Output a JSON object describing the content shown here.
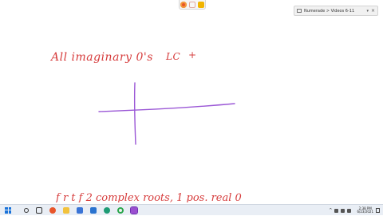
{
  "toolbar": {
    "app_icon": "firefox-icon",
    "pen_icon": "pen-icon",
    "grid_icon": "grid-icon"
  },
  "tab": {
    "label": "Numerade > Videos 6-11",
    "caret": "▾",
    "close": "×"
  },
  "notes": {
    "line1": "All imaginary 0's",
    "lc": "LC",
    "plus": "+",
    "bottom": "f      r    t       f              2 complex roots, 1 pos. real 0"
  },
  "colors": {
    "ink_red": "#d63b3b",
    "ink_purple": "#9b58d6",
    "taskbar": "#e9eef5"
  },
  "taskbar": {
    "clock_time": "2:38 PM",
    "clock_date": "6/23/2021",
    "tray_caret": "^"
  }
}
